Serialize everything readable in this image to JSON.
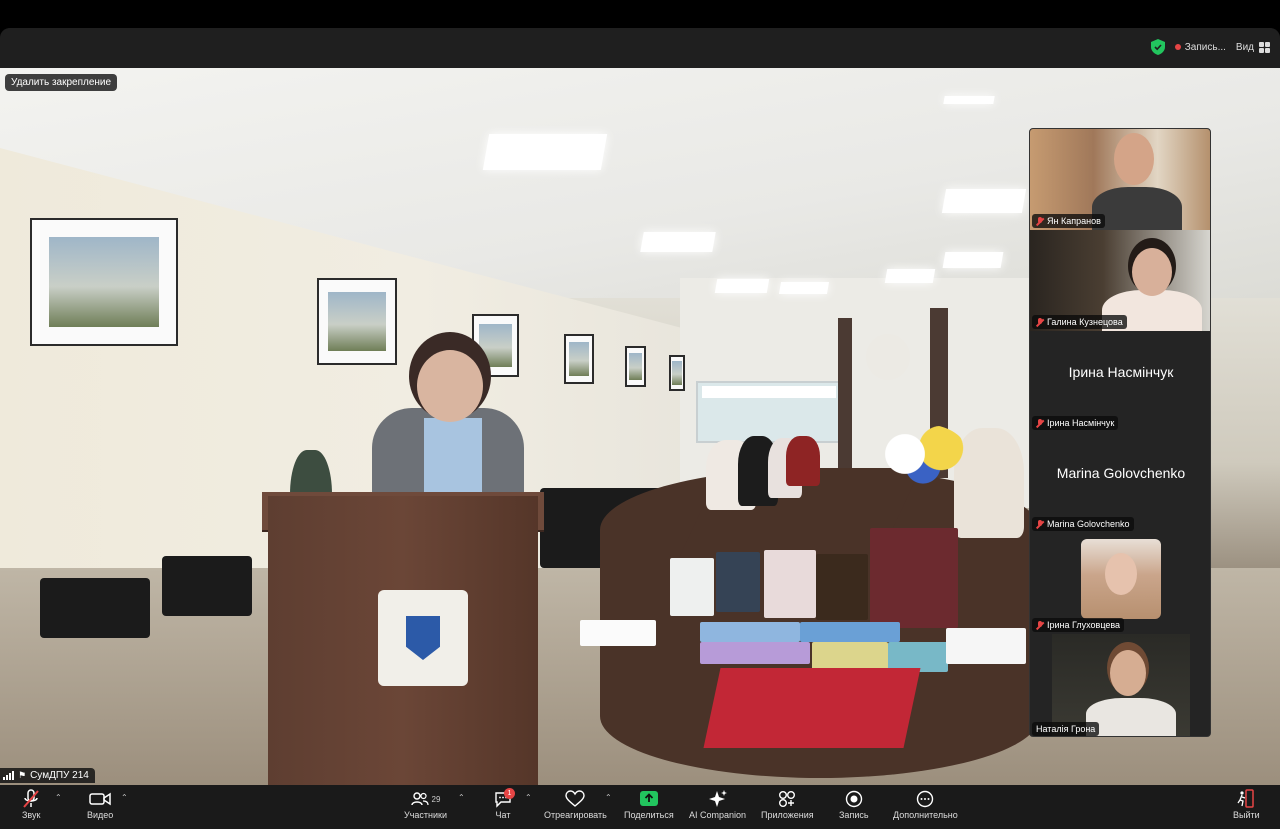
{
  "titlebar": {
    "recording_label": "Запись...",
    "view_label": "Вид"
  },
  "stage": {
    "unpin_label": "Удалить закрепление",
    "main_participant": "СумДПУ 214"
  },
  "gallery": [
    {
      "name": "Ян Капранов",
      "type": "video",
      "muted": true
    },
    {
      "name": "Галина Кузнецова",
      "type": "video",
      "muted": true
    },
    {
      "name": "Ірина Насмінчук",
      "type": "name",
      "muted": true
    },
    {
      "name": "Marina Golovchenko",
      "type": "name",
      "muted": true
    },
    {
      "name": "Ірина Глуховцева",
      "type": "photo",
      "muted": true
    },
    {
      "name": "Наталія Грона",
      "type": "video",
      "muted": false
    }
  ],
  "toolbar": {
    "audio": "Звук",
    "video": "Видео",
    "participants": "Участники",
    "participants_count": "29",
    "chat": "Чат",
    "chat_badge": "1",
    "react": "Отреагировать",
    "share": "Поделиться",
    "ai": "AI Companion",
    "apps": "Приложения",
    "record": "Запись",
    "more": "Дополнительно",
    "leave": "Выйти"
  },
  "colors": {
    "accent_green": "#22c55e",
    "muted_red": "#e64545",
    "toolbar_bg": "#1a1a1a"
  }
}
